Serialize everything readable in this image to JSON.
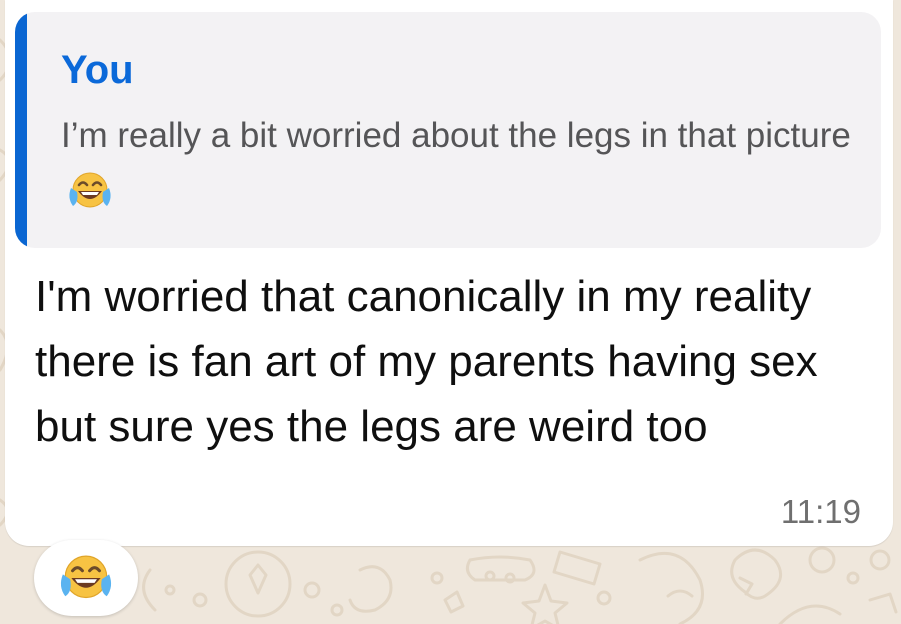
{
  "background": {
    "color": "#efe7dc",
    "pattern_icon": "doodle-pattern"
  },
  "message": {
    "quoted": {
      "author": "You",
      "author_color": "#0b69d9",
      "bar_color": "#0a66d2",
      "text": "I’m really a bit worried about the legs in that picture",
      "emoji": "face-with-tears-of-joy-icon"
    },
    "text": "I'm worried that canonically in my reality there is fan art of my parents having sex but sure yes the legs are weird too",
    "timestamp": "11:19"
  },
  "reaction": {
    "emoji": "face-with-tears-of-joy-icon"
  }
}
